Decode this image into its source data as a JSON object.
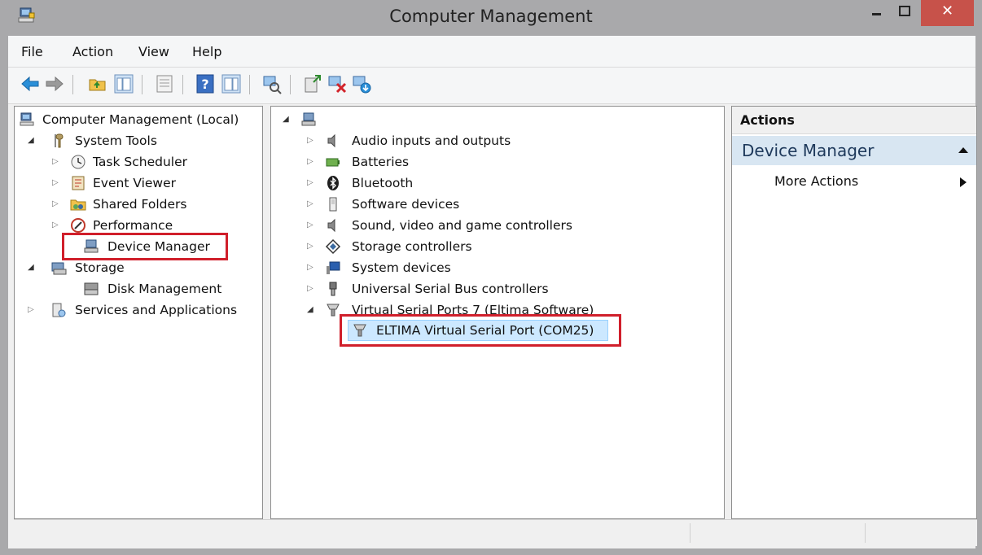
{
  "window": {
    "title": "Computer Management",
    "close_glyph": "✕",
    "minimize_glyph": "‒",
    "maximize_glyph": "□"
  },
  "menu": {
    "items": [
      "File",
      "Action",
      "View",
      "Help"
    ]
  },
  "toolbar": {
    "buttons": [
      "back-arrow-icon",
      "forward-arrow-icon",
      "up-folder-icon",
      "show-hide-console-tree-icon",
      "properties-icon",
      "help-icon",
      "show-hide-action-pane-icon",
      "scan-hardware-icon",
      "update-driver-icon",
      "uninstall-device-icon",
      "enable-device-icon"
    ]
  },
  "left_tree": {
    "root": "Computer Management (Local)",
    "items": [
      {
        "label": "System Tools",
        "level": 1,
        "expander": "expanded"
      },
      {
        "label": "Task Scheduler",
        "level": 2,
        "expander": "collapsed"
      },
      {
        "label": "Event Viewer",
        "level": 2,
        "expander": "collapsed"
      },
      {
        "label": "Shared Folders",
        "level": 2,
        "expander": "collapsed"
      },
      {
        "label": "Performance",
        "level": 2,
        "expander": "collapsed"
      },
      {
        "label": "Device Manager",
        "level": 2,
        "expander": "none"
      },
      {
        "label": "Storage",
        "level": 1,
        "expander": "expanded"
      },
      {
        "label": "Disk Management",
        "level": 2,
        "expander": "none"
      },
      {
        "label": "Services and Applications",
        "level": 1,
        "expander": "collapsed"
      }
    ]
  },
  "device_tree": {
    "items": [
      "Audio inputs and outputs",
      "Batteries",
      "Bluetooth",
      "Software devices",
      "Sound, video and game controllers",
      "Storage controllers",
      "System devices",
      "Universal Serial Bus controllers",
      "Virtual Serial Ports 7 (Eltima Software)"
    ],
    "child": "ELTIMA Virtual Serial Port (COM25)"
  },
  "actions": {
    "header": "Actions",
    "section": "Device Manager",
    "more": "More Actions"
  },
  "colors": {
    "titlebar": "#a9a9ab",
    "close": "#c7524a",
    "highlight": "#d01f2b",
    "actions_section_bg": "#d8e6f2"
  }
}
